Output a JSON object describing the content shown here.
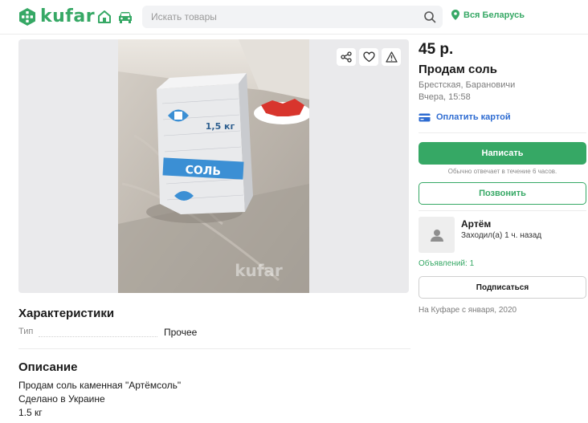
{
  "header": {
    "logo_text": "kufar",
    "search_placeholder": "Искать товары",
    "region": "Вся Беларусь"
  },
  "listing": {
    "price": "45 р.",
    "title": "Продам соль",
    "location": "Брестская, Барановичи",
    "date": "Вчера, 15:58",
    "pay_link": "Оплатить картой",
    "write_button": "Написать",
    "reply_note": "Обычно отвечает в течение 6 часов.",
    "call_button": "Позвонить"
  },
  "seller": {
    "name": "Артём",
    "last_seen": "Заходил(а) 1 ч. назад",
    "ads_count": "Объявлений: 1",
    "subscribe_button": "Подписаться",
    "since": "На Куфаре с января, 2020"
  },
  "characteristics": {
    "heading": "Характеристики",
    "rows": [
      {
        "key": "Тип",
        "value": "Прочее"
      }
    ]
  },
  "description": {
    "heading": "Описание",
    "lines": [
      "Продам соль каменная \"Артёмсоль\"",
      "Сделано в Украине",
      "1.5 кг"
    ]
  },
  "photo": {
    "package_weight": "1,5 кг",
    "package_label": "СОЛЬ",
    "watermark": "kufar"
  },
  "colors": {
    "brand_green": "#36a865",
    "link_blue": "#2d6bd1"
  },
  "icons": [
    "logo-icon",
    "home-icon",
    "car-icon",
    "search-icon",
    "location-pin-icon",
    "share-icon",
    "heart-icon",
    "warning-icon",
    "card-icon",
    "user-icon"
  ]
}
